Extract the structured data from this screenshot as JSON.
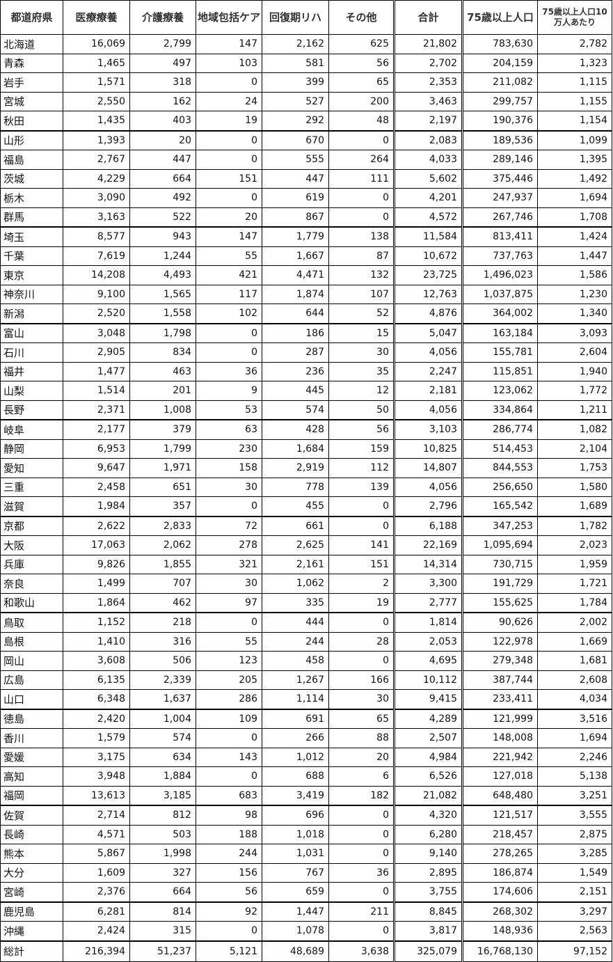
{
  "table": {
    "headers": [
      "都道府県",
      "医療療養",
      "介護療養",
      "地域包括ケア",
      "回復期リハ",
      "その他",
      "合計",
      "75歳以上人口",
      "75歳以上人口10万人あたり"
    ],
    "rows": [
      [
        "北海道",
        "16,069",
        "2,799",
        "147",
        "2,162",
        "625",
        "21,802",
        "783,630",
        "2,782"
      ],
      [
        "青森",
        "1,465",
        "497",
        "103",
        "581",
        "56",
        "2,702",
        "204,159",
        "1,323"
      ],
      [
        "岩手",
        "1,571",
        "318",
        "0",
        "399",
        "65",
        "2,353",
        "211,082",
        "1,115"
      ],
      [
        "宮城",
        "2,550",
        "162",
        "24",
        "527",
        "200",
        "3,463",
        "299,757",
        "1,155"
      ],
      [
        "秋田",
        "1,435",
        "403",
        "19",
        "292",
        "48",
        "2,197",
        "190,376",
        "1,154"
      ],
      [
        "山形",
        "1,393",
        "20",
        "0",
        "670",
        "0",
        "2,083",
        "189,536",
        "1,099"
      ],
      [
        "福島",
        "2,767",
        "447",
        "0",
        "555",
        "264",
        "4,033",
        "289,146",
        "1,395"
      ],
      [
        "茨城",
        "4,229",
        "664",
        "151",
        "447",
        "111",
        "5,602",
        "375,446",
        "1,492"
      ],
      [
        "栃木",
        "3,090",
        "492",
        "0",
        "619",
        "0",
        "4,201",
        "247,937",
        "1,694"
      ],
      [
        "群馬",
        "3,163",
        "522",
        "20",
        "867",
        "0",
        "4,572",
        "267,746",
        "1,708"
      ],
      [
        "埼玉",
        "8,577",
        "943",
        "147",
        "1,779",
        "138",
        "11,584",
        "813,411",
        "1,424"
      ],
      [
        "千葉",
        "7,619",
        "1,244",
        "55",
        "1,667",
        "87",
        "10,672",
        "737,763",
        "1,447"
      ],
      [
        "東京",
        "14,208",
        "4,493",
        "421",
        "4,471",
        "132",
        "23,725",
        "1,496,023",
        "1,586"
      ],
      [
        "神奈川",
        "9,100",
        "1,565",
        "117",
        "1,874",
        "107",
        "12,763",
        "1,037,875",
        "1,230"
      ],
      [
        "新潟",
        "2,520",
        "1,558",
        "102",
        "644",
        "52",
        "4,876",
        "364,002",
        "1,340"
      ],
      [
        "富山",
        "3,048",
        "1,798",
        "0",
        "186",
        "15",
        "5,047",
        "163,184",
        "3,093"
      ],
      [
        "石川",
        "2,905",
        "834",
        "0",
        "287",
        "30",
        "4,056",
        "155,781",
        "2,604"
      ],
      [
        "福井",
        "1,477",
        "463",
        "36",
        "236",
        "35",
        "2,247",
        "115,851",
        "1,940"
      ],
      [
        "山梨",
        "1,514",
        "201",
        "9",
        "445",
        "12",
        "2,181",
        "123,062",
        "1,772"
      ],
      [
        "長野",
        "2,371",
        "1,008",
        "53",
        "574",
        "50",
        "4,056",
        "334,864",
        "1,211"
      ],
      [
        "岐阜",
        "2,177",
        "379",
        "63",
        "428",
        "56",
        "3,103",
        "286,774",
        "1,082"
      ],
      [
        "静岡",
        "6,953",
        "1,799",
        "230",
        "1,684",
        "159",
        "10,825",
        "514,453",
        "2,104"
      ],
      [
        "愛知",
        "9,647",
        "1,971",
        "158",
        "2,919",
        "112",
        "14,807",
        "844,553",
        "1,753"
      ],
      [
        "三重",
        "2,458",
        "651",
        "30",
        "778",
        "139",
        "4,056",
        "256,650",
        "1,580"
      ],
      [
        "滋賀",
        "1,984",
        "357",
        "0",
        "455",
        "0",
        "2,796",
        "165,542",
        "1,689"
      ],
      [
        "京都",
        "2,622",
        "2,833",
        "72",
        "661",
        "0",
        "6,188",
        "347,253",
        "1,782"
      ],
      [
        "大阪",
        "17,063",
        "2,062",
        "278",
        "2,625",
        "141",
        "22,169",
        "1,095,694",
        "2,023"
      ],
      [
        "兵庫",
        "9,826",
        "1,855",
        "321",
        "2,161",
        "151",
        "14,314",
        "730,715",
        "1,959"
      ],
      [
        "奈良",
        "1,499",
        "707",
        "30",
        "1,062",
        "2",
        "3,300",
        "191,729",
        "1,721"
      ],
      [
        "和歌山",
        "1,864",
        "462",
        "97",
        "335",
        "19",
        "2,777",
        "155,625",
        "1,784"
      ],
      [
        "鳥取",
        "1,152",
        "218",
        "0",
        "444",
        "0",
        "1,814",
        "90,626",
        "2,002"
      ],
      [
        "島根",
        "1,410",
        "316",
        "55",
        "244",
        "28",
        "2,053",
        "122,978",
        "1,669"
      ],
      [
        "岡山",
        "3,608",
        "506",
        "123",
        "458",
        "0",
        "4,695",
        "279,348",
        "1,681"
      ],
      [
        "広島",
        "6,135",
        "2,339",
        "205",
        "1,267",
        "166",
        "10,112",
        "387,744",
        "2,608"
      ],
      [
        "山口",
        "6,348",
        "1,637",
        "286",
        "1,114",
        "30",
        "9,415",
        "233,411",
        "4,034"
      ],
      [
        "徳島",
        "2,420",
        "1,004",
        "109",
        "691",
        "65",
        "4,289",
        "121,999",
        "3,516"
      ],
      [
        "香川",
        "1,579",
        "574",
        "0",
        "266",
        "88",
        "2,507",
        "148,008",
        "1,694"
      ],
      [
        "愛媛",
        "3,175",
        "634",
        "143",
        "1,012",
        "20",
        "4,984",
        "221,942",
        "2,246"
      ],
      [
        "高知",
        "3,948",
        "1,884",
        "0",
        "688",
        "6",
        "6,526",
        "127,018",
        "5,138"
      ],
      [
        "福岡",
        "13,613",
        "3,185",
        "683",
        "3,419",
        "182",
        "21,082",
        "648,480",
        "3,251"
      ],
      [
        "佐賀",
        "2,714",
        "812",
        "98",
        "696",
        "0",
        "4,320",
        "121,517",
        "3,555"
      ],
      [
        "長崎",
        "4,571",
        "503",
        "188",
        "1,018",
        "0",
        "6,280",
        "218,457",
        "2,875"
      ],
      [
        "熊本",
        "5,867",
        "1,998",
        "244",
        "1,031",
        "0",
        "9,140",
        "278,265",
        "3,285"
      ],
      [
        "大分",
        "1,609",
        "327",
        "156",
        "767",
        "36",
        "2,895",
        "186,874",
        "1,549"
      ],
      [
        "宮崎",
        "2,376",
        "664",
        "56",
        "659",
        "0",
        "3,755",
        "174,606",
        "2,151"
      ],
      [
        "鹿児島",
        "6,281",
        "814",
        "92",
        "1,447",
        "211",
        "8,845",
        "268,302",
        "3,297"
      ],
      [
        "沖縄",
        "2,424",
        "315",
        "0",
        "1,078",
        "0",
        "3,817",
        "148,936",
        "2,563"
      ]
    ],
    "total": [
      "総計",
      "216,394",
      "51,237",
      "5,121",
      "48,689",
      "3,638",
      "325,079",
      "16,768,130",
      "97,152"
    ]
  }
}
